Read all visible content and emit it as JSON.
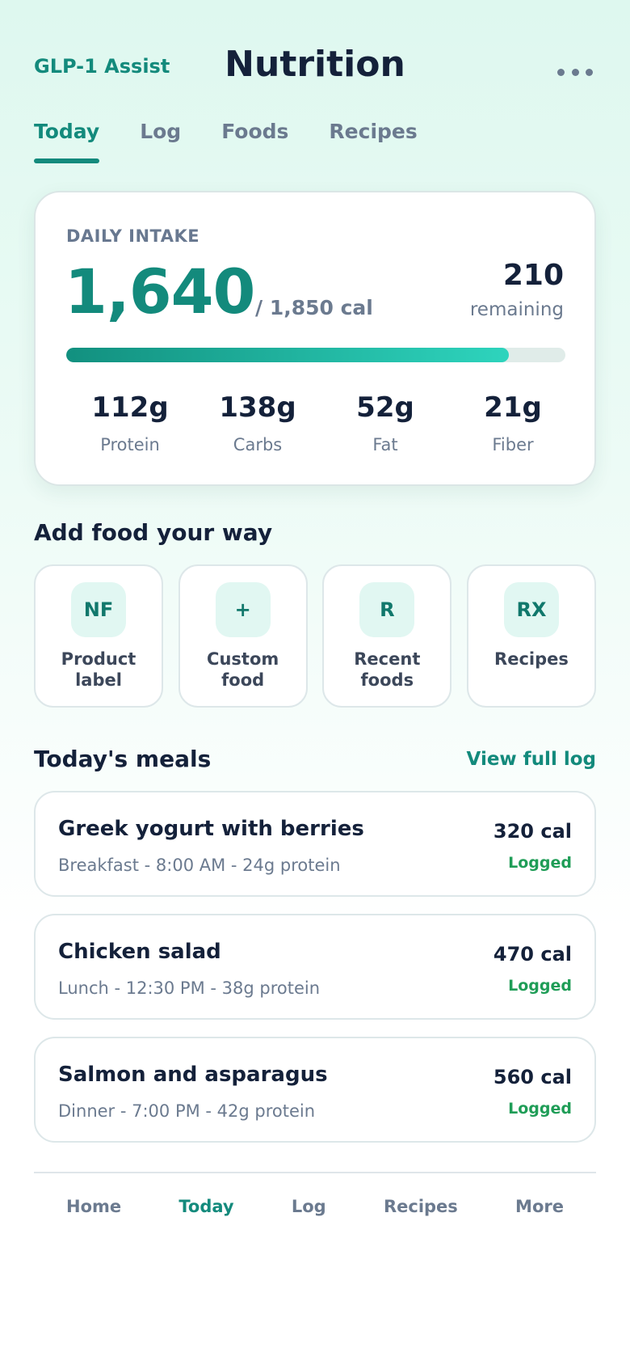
{
  "header": {
    "brand": "GLP-1 Assist",
    "title": "Nutrition",
    "more_icon": "more-horizontal-icon"
  },
  "tabs": [
    {
      "label": "Today",
      "active": true
    },
    {
      "label": "Log",
      "active": false
    },
    {
      "label": "Foods",
      "active": false
    },
    {
      "label": "Recipes",
      "active": false
    }
  ],
  "intake": {
    "label": "DAILY INTAKE",
    "value": "1,640",
    "goal": "/ 1,850 cal",
    "remaining_value": "210",
    "remaining_label": "remaining",
    "progress_fraction": 0.886,
    "macros": [
      {
        "value": "112g",
        "label": "Protein"
      },
      {
        "value": "138g",
        "label": "Carbs"
      },
      {
        "value": "52g",
        "label": "Fat"
      },
      {
        "value": "21g",
        "label": "Fiber"
      }
    ]
  },
  "add_food": {
    "title": "Add food your way",
    "options": [
      {
        "icon": "NF",
        "label": "Product label"
      },
      {
        "icon": "+",
        "label": "Custom food"
      },
      {
        "icon": "R",
        "label": "Recent foods"
      },
      {
        "icon": "RX",
        "label": "Recipes"
      }
    ]
  },
  "meals": {
    "title": "Today's meals",
    "view_all": "View full log",
    "items": [
      {
        "name": "Greek yogurt with berries",
        "detail": "Breakfast - 8:00 AM - 24g protein",
        "calories": "320 cal",
        "status": "Logged"
      },
      {
        "name": "Chicken salad",
        "detail": "Lunch - 12:30 PM - 38g protein",
        "calories": "470 cal",
        "status": "Logged"
      },
      {
        "name": "Salmon and asparagus",
        "detail": "Dinner - 7:00 PM - 42g protein",
        "calories": "560 cal",
        "status": "Logged"
      }
    ]
  },
  "bottom_nav": [
    {
      "label": "Home",
      "active": false
    },
    {
      "label": "Today",
      "active": true
    },
    {
      "label": "Log",
      "active": false
    },
    {
      "label": "Recipes",
      "active": false
    },
    {
      "label": "More",
      "active": false
    }
  ],
  "colors": {
    "accent": "#138a7c",
    "success": "#1f9d57",
    "text": "#14213a",
    "muted": "#6b7a8f"
  }
}
